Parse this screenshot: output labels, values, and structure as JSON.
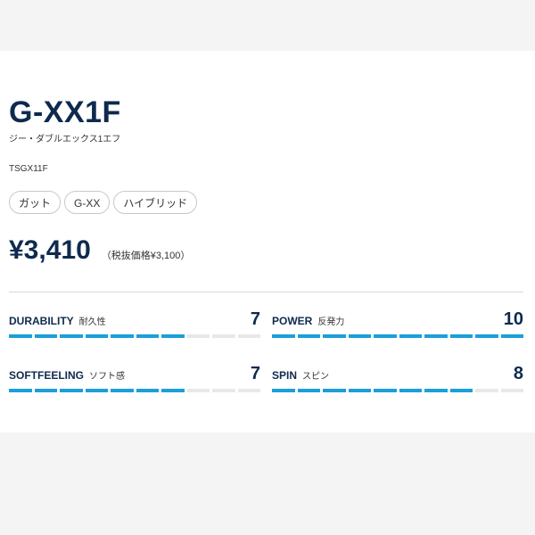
{
  "product": {
    "name": "G-XX1F",
    "kana": "ジー・ダブルエックス1エフ",
    "code": "TSGX11F",
    "tags": [
      "ガット",
      "G-XX",
      "ハイブリッド"
    ],
    "price": "¥3,410",
    "price_note": "（税抜価格¥3,100）"
  },
  "stats": [
    {
      "name": "DURABILITY",
      "jp": "耐久性",
      "value": 7,
      "max": 10
    },
    {
      "name": "POWER",
      "jp": "反発力",
      "value": 10,
      "max": 10
    },
    {
      "name": "SOFTFEELING",
      "jp": "ソフト感",
      "value": 7,
      "max": 10
    },
    {
      "name": "SPIN",
      "jp": "スピン",
      "value": 8,
      "max": 10
    }
  ],
  "colors": {
    "accent": "#1a9fd9",
    "track": "#e8e8e8",
    "text": "#0f2a4e"
  }
}
